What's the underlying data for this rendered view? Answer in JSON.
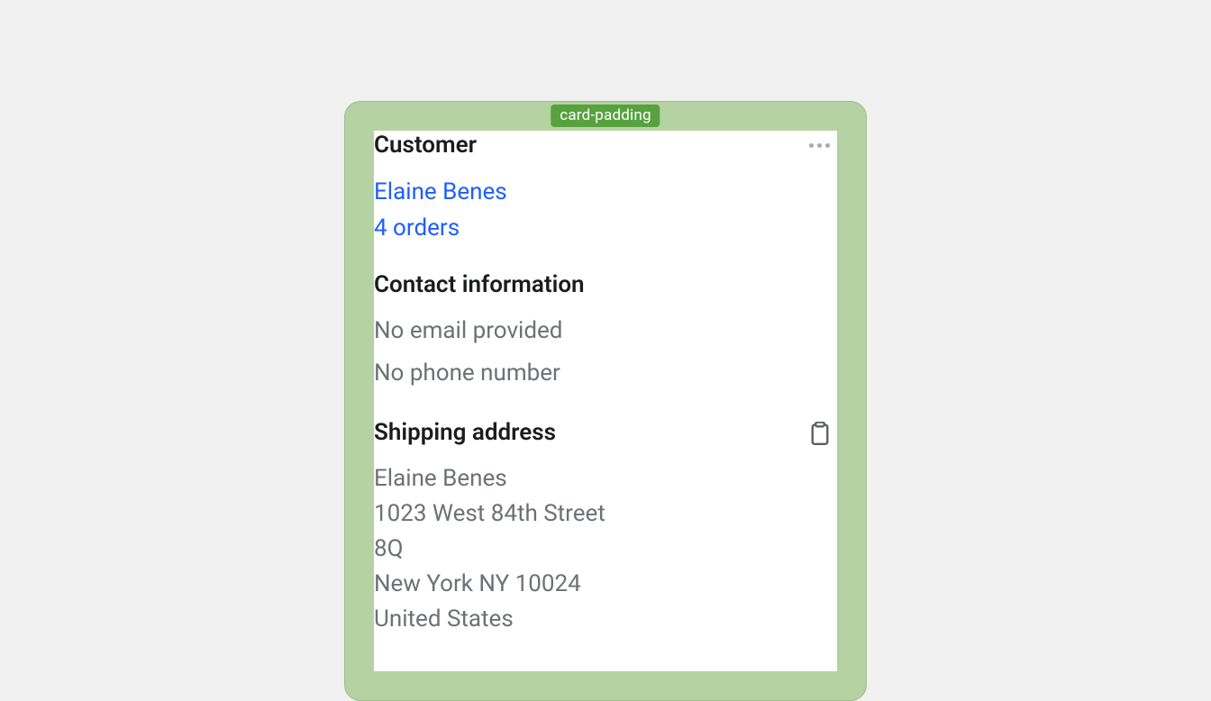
{
  "badge": "card-padding",
  "customer": {
    "heading": "Customer",
    "name": "Elaine Benes",
    "orders": "4 orders"
  },
  "contact": {
    "heading": "Contact information",
    "email": "No email provided",
    "phone": "No phone number"
  },
  "shipping": {
    "heading": "Shipping address",
    "lines": [
      "Elaine Benes",
      "1023 West 84th Street",
      "8Q",
      "New York NY 10024",
      "United States"
    ]
  }
}
